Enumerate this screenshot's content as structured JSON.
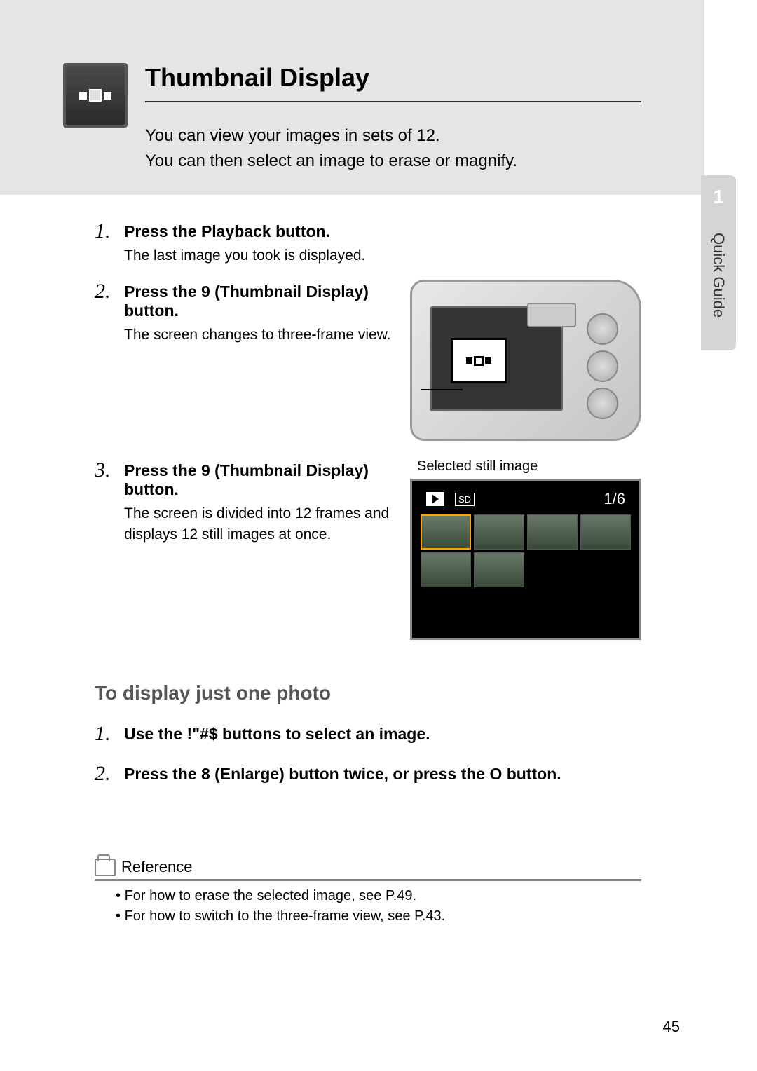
{
  "sideTab": {
    "number": "1",
    "label": "Quick Guide"
  },
  "header": {
    "title": "Thumbnail Display",
    "intro1": "You can view your images in sets of 12.",
    "intro2": "You can then select an image to erase or magnify."
  },
  "steps": [
    {
      "num": "1.",
      "title": "Press the Playback button.",
      "desc": "The last image you took is displayed."
    },
    {
      "num": "2.",
      "title": "Press the 9 (Thumbnail Display) button.",
      "desc": "The screen changes to three-frame view."
    },
    {
      "num": "3.",
      "title": "Press the 9 (Thumbnail Display) button.",
      "desc": "The screen is divided into 12 frames and displays 12 still images at once."
    }
  ],
  "captionLabel": "Selected still image",
  "lcdCount": "1/6",
  "sdLabel": "SD",
  "subsection": {
    "title": "To display just one photo",
    "steps": [
      {
        "num": "1.",
        "title": "Use the !\"#$ buttons to select an image."
      },
      {
        "num": "2.",
        "title": " Press the 8 (Enlarge) button twice, or press the O   button."
      }
    ]
  },
  "reference": {
    "title": "Reference",
    "items": [
      "For how to erase the selected image, see P.49.",
      "For how to switch to the three-frame view, see P.43."
    ]
  },
  "pageNumber": "45"
}
